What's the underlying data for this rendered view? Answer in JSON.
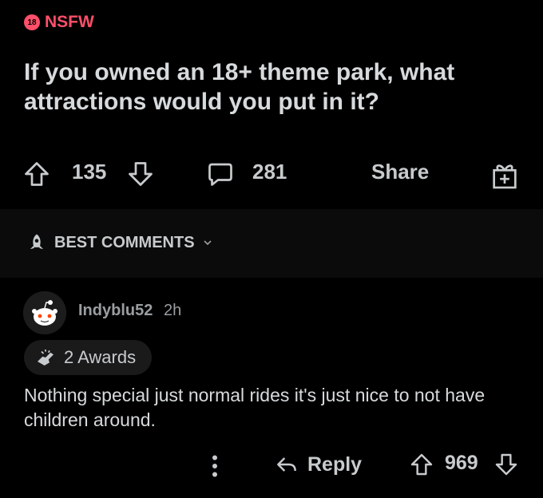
{
  "post": {
    "nsfw_badge": "18",
    "nsfw_label": "NSFW",
    "title": "If you owned an 18+ theme park, what attractions would you put in it?",
    "upvotes": "135",
    "comments": "281",
    "share_label": "Share"
  },
  "sort": {
    "label": "BEST COMMENTS"
  },
  "comment": {
    "username": "Indyblu52",
    "time": "2h",
    "awards": "2 Awards",
    "body": "Nothing special just normal rides it's just nice to not have children around.",
    "reply_label": "Reply",
    "score": "969"
  },
  "colors": {
    "nsfw": "#ff4f6a",
    "background": "#000000",
    "text": "#d7dadc"
  }
}
